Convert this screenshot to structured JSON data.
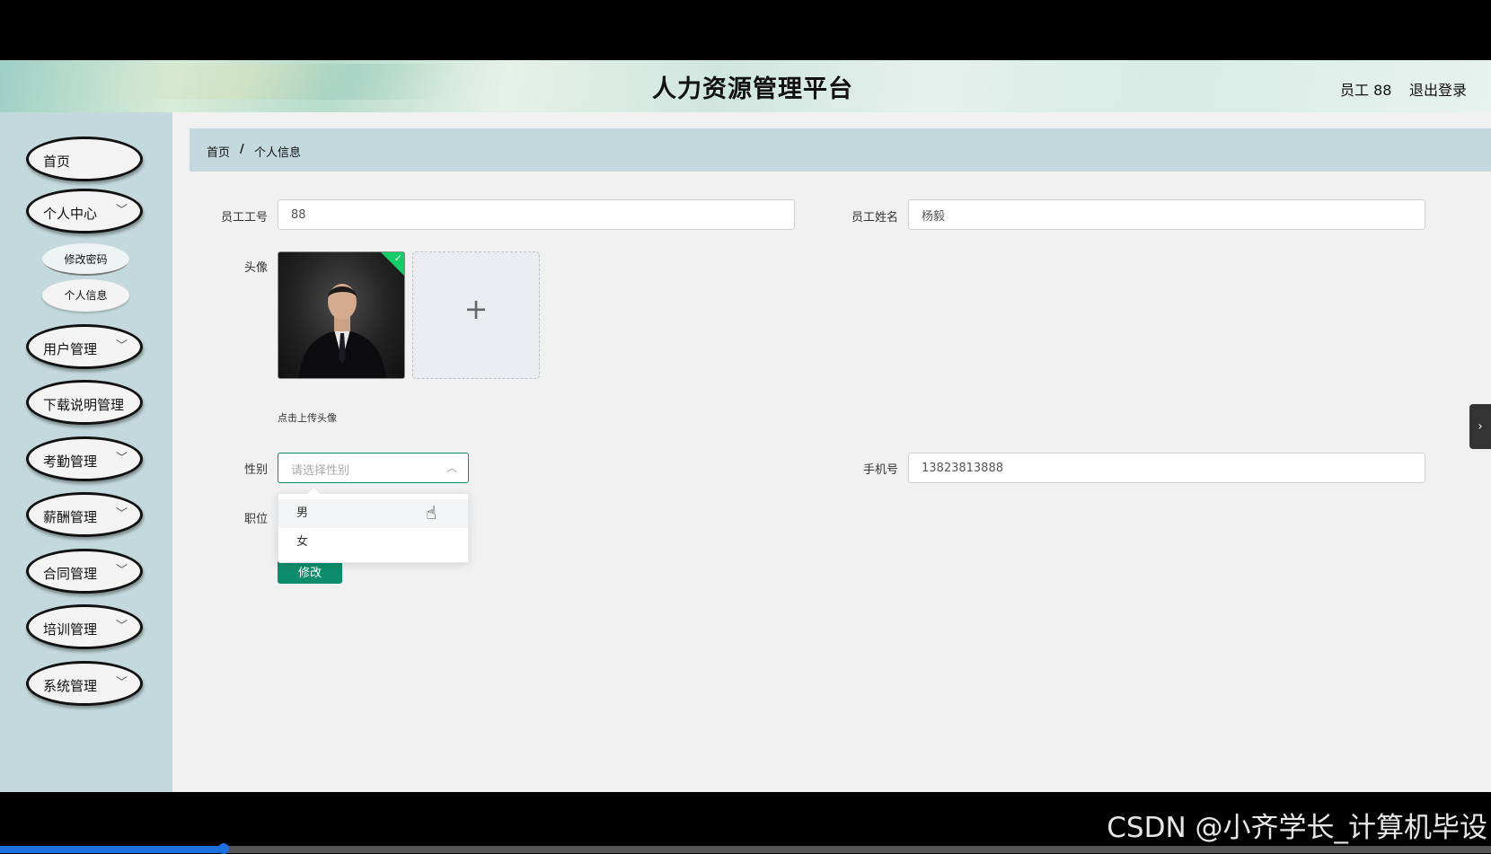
{
  "header": {
    "title": "人力资源管理平台",
    "user": "员工 88",
    "logout": "退出登录"
  },
  "sidebar": {
    "items": [
      {
        "label": "首页"
      },
      {
        "label": "个人中心",
        "expanded": true,
        "children": [
          "修改密码",
          "个人信息"
        ]
      },
      {
        "label": "用户管理"
      },
      {
        "label": "下载说明管理"
      },
      {
        "label": "考勤管理"
      },
      {
        "label": "薪酬管理"
      },
      {
        "label": "合同管理"
      },
      {
        "label": "培训管理"
      },
      {
        "label": "系统管理"
      }
    ],
    "active": "个人信息"
  },
  "breadcrumb": {
    "home": "首页",
    "sep": "/",
    "current": "个人信息"
  },
  "form": {
    "employee_id": {
      "label": "员工工号",
      "value": "88"
    },
    "employee_name": {
      "label": "员工姓名",
      "value": "杨毅"
    },
    "avatar": {
      "label": "头像",
      "tip": "点击上传头像",
      "upload_icon": "plus-icon"
    },
    "gender": {
      "label": "性别",
      "placeholder": "请选择性别",
      "options": [
        "男",
        "女"
      ],
      "hovered": "男"
    },
    "phone": {
      "label": "手机号",
      "value": "13823813888"
    },
    "position": {
      "label": "职位"
    },
    "submit": "修改"
  },
  "watermark": "CSDN @小齐学长_计算机毕设",
  "video_progress": 0.15,
  "colors": {
    "accent": "#0e8d6c",
    "sidebar_bg": "#c3d9dd",
    "content_bg": "#f1f1f1"
  }
}
